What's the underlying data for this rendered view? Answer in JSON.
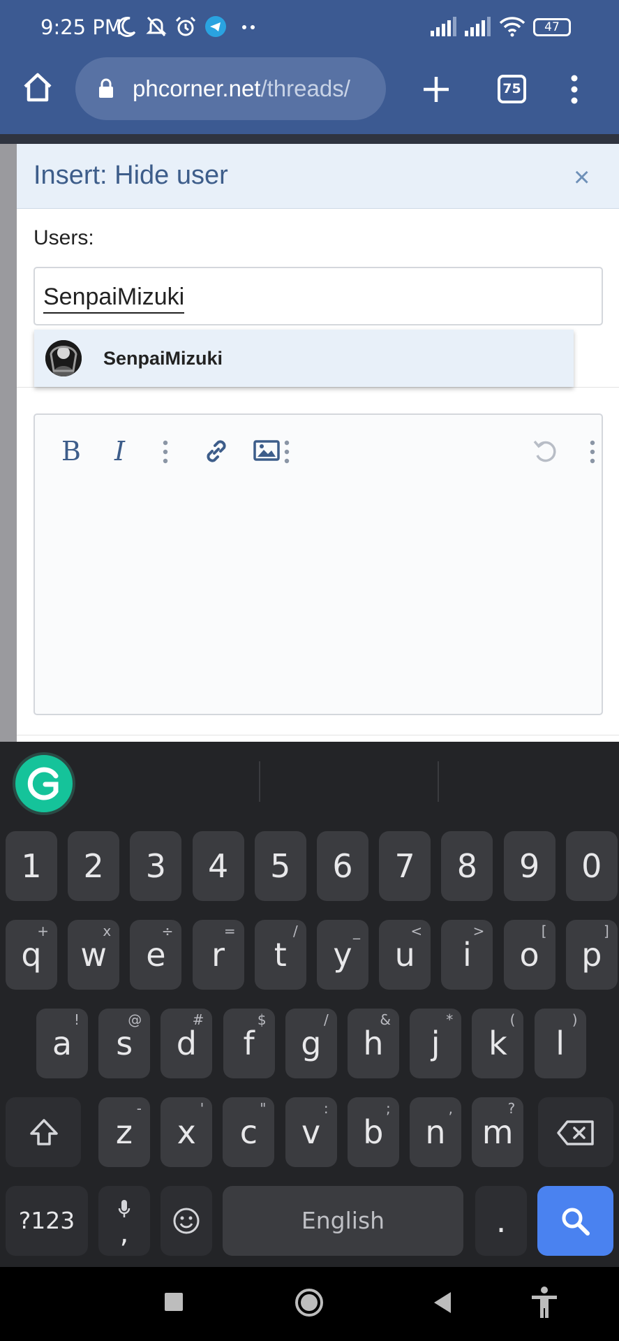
{
  "status_bar": {
    "time": "9:25 PM",
    "battery": "47"
  },
  "browser": {
    "url_domain": "phcorner.net",
    "url_path": "/threads/",
    "tab_count": "75"
  },
  "dialog": {
    "title": "Insert: Hide user",
    "close_label": "×",
    "users_label": "Users:",
    "users_value": "SenpaiMizuki",
    "suggestion": {
      "name": "SenpaiMizuki"
    },
    "toolbar": {
      "bold": "B",
      "italic": "I"
    }
  },
  "keyboard": {
    "rows": {
      "numbers": [
        {
          "label": "1"
        },
        {
          "label": "2"
        },
        {
          "label": "3"
        },
        {
          "label": "4"
        },
        {
          "label": "5"
        },
        {
          "label": "6"
        },
        {
          "label": "7"
        },
        {
          "label": "8"
        },
        {
          "label": "9"
        },
        {
          "label": "0"
        }
      ],
      "top": [
        {
          "label": "q",
          "hint": "+"
        },
        {
          "label": "w",
          "hint": "x"
        },
        {
          "label": "e",
          "hint": "÷"
        },
        {
          "label": "r",
          "hint": "="
        },
        {
          "label": "t",
          "hint": "/"
        },
        {
          "label": "y",
          "hint": "_"
        },
        {
          "label": "u",
          "hint": "<"
        },
        {
          "label": "i",
          "hint": ">"
        },
        {
          "label": "o",
          "hint": "["
        },
        {
          "label": "p",
          "hint": "]"
        }
      ],
      "middle": [
        {
          "label": "a",
          "hint": "!"
        },
        {
          "label": "s",
          "hint": "@"
        },
        {
          "label": "d",
          "hint": "#"
        },
        {
          "label": "f",
          "hint": "$"
        },
        {
          "label": "g",
          "hint": "/"
        },
        {
          "label": "h",
          "hint": "&"
        },
        {
          "label": "j",
          "hint": "*"
        },
        {
          "label": "k",
          "hint": "("
        },
        {
          "label": "l",
          "hint": ")"
        }
      ],
      "bottom": [
        {
          "label": "z",
          "hint": "-"
        },
        {
          "label": "x",
          "hint": "'"
        },
        {
          "label": "c",
          "hint": "\""
        },
        {
          "label": "v",
          "hint": ":"
        },
        {
          "label": "b",
          "hint": ";"
        },
        {
          "label": "n",
          "hint": ","
        },
        {
          "label": "m",
          "hint": "?"
        }
      ]
    },
    "symbols_key": "?123",
    "comma_key": ",",
    "space_label": "English",
    "period_key": "."
  },
  "colors": {
    "browser_bar": "#3c5a92",
    "dialog_header": "#e8f0f9",
    "dialog_title": "#3d5d8a",
    "grammarly": "#15c39a",
    "search_key": "#4a82f0"
  },
  "icons": [
    "home-icon",
    "lock-icon",
    "plus-icon",
    "menu-dots-icon",
    "link-icon",
    "image-icon",
    "undo-icon",
    "grammarly-icon",
    "shift-icon",
    "backspace-icon",
    "mic-icon",
    "emoji-icon",
    "search-icon",
    "recents-icon",
    "home-circle-icon",
    "back-icon",
    "accessibility-icon"
  ]
}
